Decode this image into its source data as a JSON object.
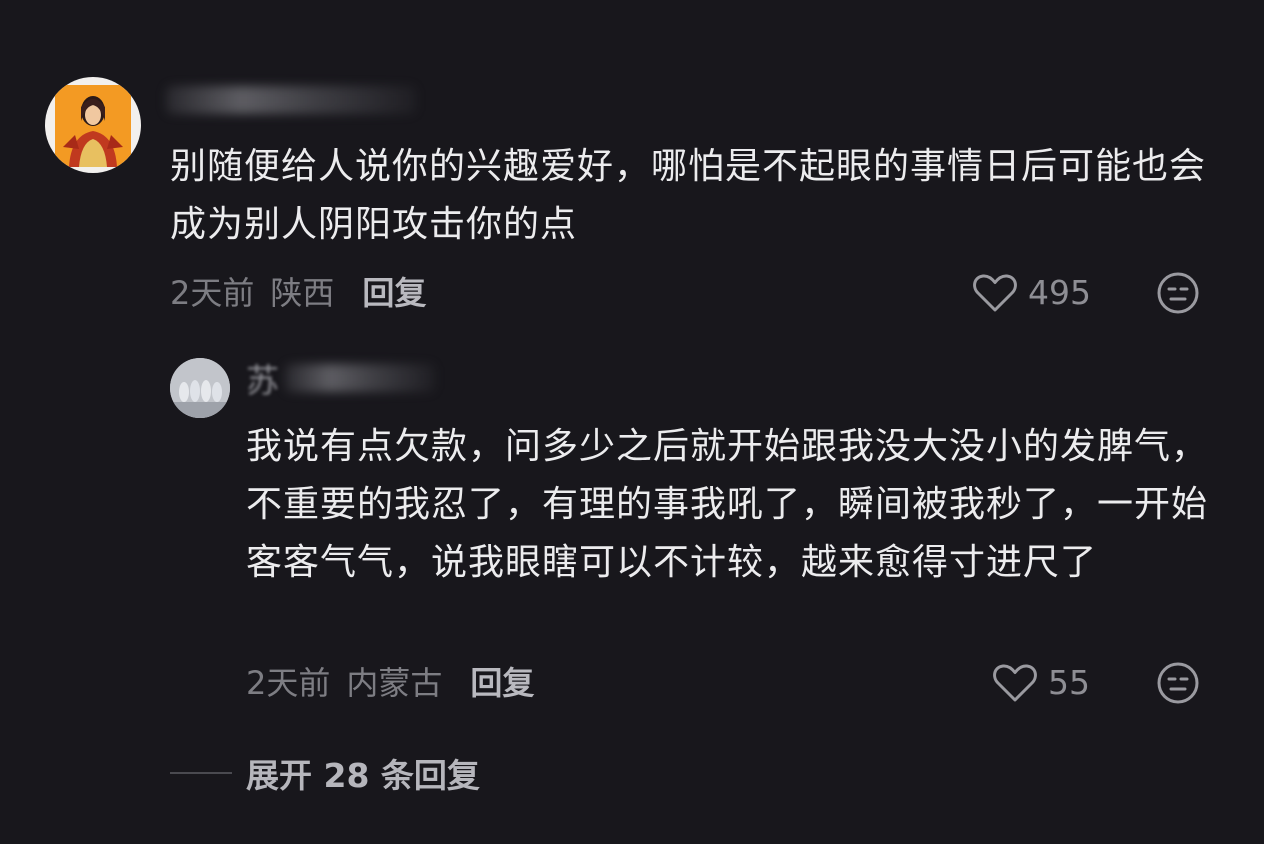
{
  "comment": {
    "text": "别随便给人说你的兴趣爱好，哪怕是不起眼的事情日后可能也会成为别人阴阳攻击你的点",
    "time": "2天前",
    "location": "陕西",
    "reply_label": "回复",
    "likes": "495"
  },
  "reply": {
    "name_visible_char": "苏",
    "text": "我说有点欠款，问多少之后就开始跟我没大没小的发脾气，不重要的我忍了，有理的事我吼了，瞬间被我秒了，一开始客客气气，说我眼瞎可以不计较，越来愈得寸进尺了",
    "time": "2天前",
    "location": "内蒙古",
    "reply_label": "回复",
    "likes": "55"
  },
  "expand": {
    "label": "展开 28 条回复"
  },
  "icons": {
    "like": "heart-outline-icon",
    "dislike": "neutral-face-icon"
  },
  "colors": {
    "background": "#18171c",
    "text": "#ececee",
    "meta": "#7d7d83"
  }
}
